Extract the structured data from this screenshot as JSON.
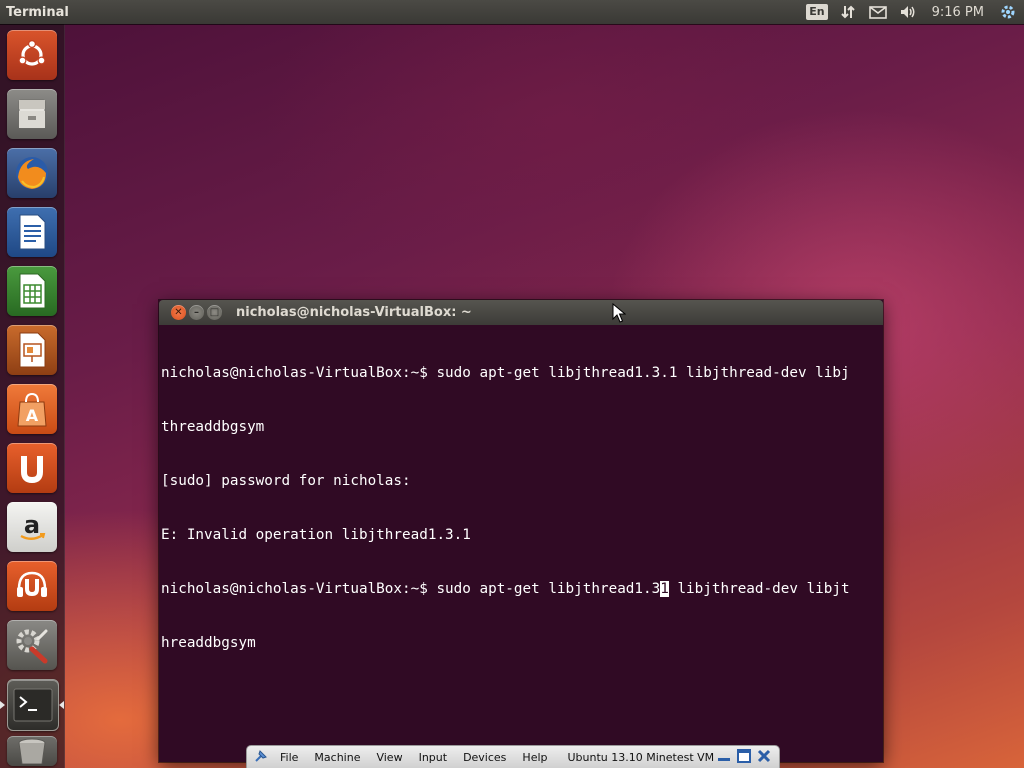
{
  "top_panel": {
    "app_title": "Terminal",
    "keyboard_layout": "En",
    "clock": "9:16 PM"
  },
  "launcher": {
    "items": [
      {
        "name": "dash-home",
        "icon": "ubuntu-logo-icon"
      },
      {
        "name": "files",
        "icon": "file-cabinet-icon"
      },
      {
        "name": "firefox",
        "icon": "firefox-icon"
      },
      {
        "name": "libreoffice-writer",
        "icon": "writer-document-icon"
      },
      {
        "name": "libreoffice-calc",
        "icon": "calc-spreadsheet-icon"
      },
      {
        "name": "libreoffice-impress",
        "icon": "impress-presentation-icon"
      },
      {
        "name": "ubuntu-software-center",
        "icon": "shopping-bag-icon"
      },
      {
        "name": "ubuntu-one",
        "icon": "ubuntu-one-icon"
      },
      {
        "name": "amazon",
        "icon": "amazon-icon"
      },
      {
        "name": "ubuntu-one-music",
        "icon": "music-headphones-icon"
      },
      {
        "name": "system-settings",
        "icon": "settings-wrench-gear-icon"
      },
      {
        "name": "terminal",
        "icon": "terminal-icon"
      },
      {
        "name": "trash",
        "icon": "trash-icon"
      }
    ]
  },
  "terminal": {
    "title": "nicholas@nicholas-VirtualBox: ~",
    "lines": [
      "nicholas@nicholas-VirtualBox:~$ sudo apt-get libjthread1.3.1 libjthread-dev libj",
      "threaddbgsym",
      "[sudo] password for nicholas:",
      "E: Invalid operation libjthread1.3.1"
    ],
    "current_line_before_cursor": "nicholas@nicholas-VirtualBox:~$ sudo apt-get libjthread1.3",
    "cursor_char": "1",
    "current_line_after_cursor": " libjthread-dev libjt",
    "current_line_wrap": "hreaddbgsym"
  },
  "vbox_toolbar": {
    "menus": [
      "File",
      "Machine",
      "View",
      "Input",
      "Devices",
      "Help"
    ],
    "vm_title": "Ubuntu 13.10 Minetest VM"
  },
  "colors": {
    "terminal_bg": "#300a24",
    "panel_bg": "#3c3b37",
    "close_button": "#e95420"
  }
}
